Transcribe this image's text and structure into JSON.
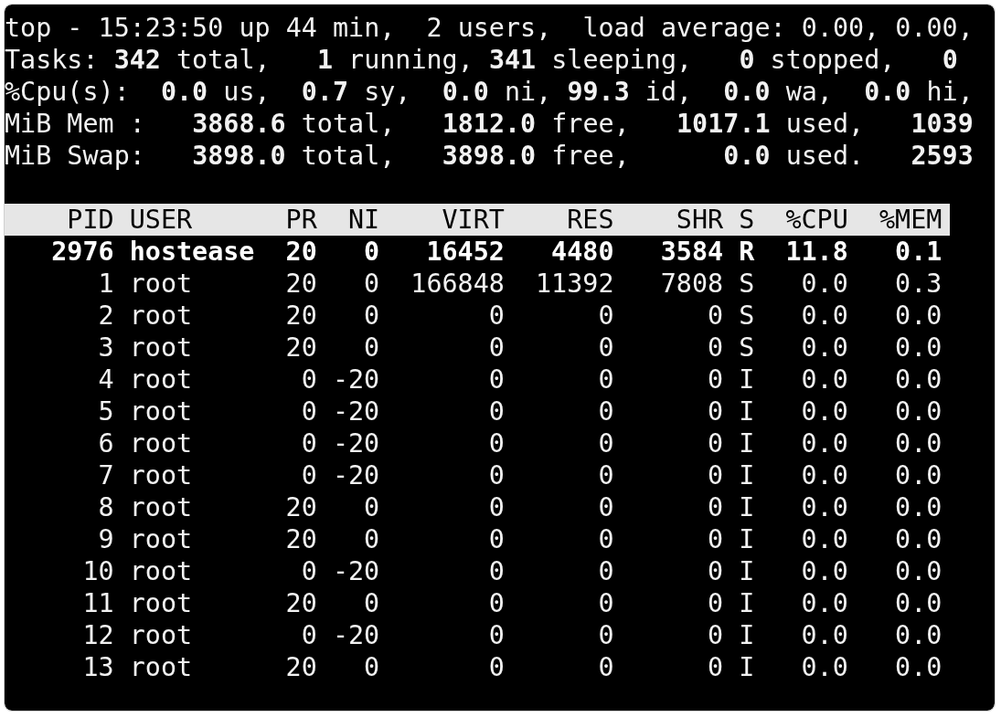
{
  "summary": [
    "top - 15:23:50 up 44 min,  2 users,  load average: 0.00, 0.00,",
    "Tasks: **342** total,   **1** running, **341** sleeping,   **0** stopped,   **0**",
    "%Cpu(s):  **0.0** us,  **0.7** sy,  **0.0** ni, **99.3** id,  **0.0** wa,  **0.0** hi,",
    "MiB Mem :   **3868.6** total,   **1812.0** free,   **1017.1** used,   **1039**",
    "MiB Swap:   **3898.0** total,   **3898.0** free,      **0.0** used.   **2593**"
  ],
  "table": {
    "columns": [
      "PID",
      "USER",
      "PR",
      "NI",
      "VIRT",
      "RES",
      "SHR",
      "S",
      "%CPU",
      "%MEM"
    ],
    "rows": [
      {
        "highlighted": true,
        "cells": [
          "2976",
          "hostease",
          "20",
          "0",
          "16452",
          "4480",
          "3584",
          "R",
          "11.8",
          "0.1"
        ]
      },
      {
        "highlighted": false,
        "cells": [
          "1",
          "root",
          "20",
          "0",
          "166848",
          "11392",
          "7808",
          "S",
          "0.0",
          "0.3"
        ]
      },
      {
        "highlighted": false,
        "cells": [
          "2",
          "root",
          "20",
          "0",
          "0",
          "0",
          "0",
          "S",
          "0.0",
          "0.0"
        ]
      },
      {
        "highlighted": false,
        "cells": [
          "3",
          "root",
          "20",
          "0",
          "0",
          "0",
          "0",
          "S",
          "0.0",
          "0.0"
        ]
      },
      {
        "highlighted": false,
        "cells": [
          "4",
          "root",
          "0",
          "-20",
          "0",
          "0",
          "0",
          "I",
          "0.0",
          "0.0"
        ]
      },
      {
        "highlighted": false,
        "cells": [
          "5",
          "root",
          "0",
          "-20",
          "0",
          "0",
          "0",
          "I",
          "0.0",
          "0.0"
        ]
      },
      {
        "highlighted": false,
        "cells": [
          "6",
          "root",
          "0",
          "-20",
          "0",
          "0",
          "0",
          "I",
          "0.0",
          "0.0"
        ]
      },
      {
        "highlighted": false,
        "cells": [
          "7",
          "root",
          "0",
          "-20",
          "0",
          "0",
          "0",
          "I",
          "0.0",
          "0.0"
        ]
      },
      {
        "highlighted": false,
        "cells": [
          "8",
          "root",
          "20",
          "0",
          "0",
          "0",
          "0",
          "I",
          "0.0",
          "0.0"
        ]
      },
      {
        "highlighted": false,
        "cells": [
          "9",
          "root",
          "20",
          "0",
          "0",
          "0",
          "0",
          "I",
          "0.0",
          "0.0"
        ]
      },
      {
        "highlighted": false,
        "cells": [
          "10",
          "root",
          "0",
          "-20",
          "0",
          "0",
          "0",
          "I",
          "0.0",
          "0.0"
        ]
      },
      {
        "highlighted": false,
        "cells": [
          "11",
          "root",
          "20",
          "0",
          "0",
          "0",
          "0",
          "I",
          "0.0",
          "0.0"
        ]
      },
      {
        "highlighted": false,
        "cells": [
          "12",
          "root",
          "0",
          "-20",
          "0",
          "0",
          "0",
          "I",
          "0.0",
          "0.0"
        ]
      },
      {
        "highlighted": false,
        "cells": [
          "13",
          "root",
          "20",
          "0",
          "0",
          "0",
          "0",
          "I",
          "0.0",
          "0.0"
        ]
      }
    ]
  }
}
